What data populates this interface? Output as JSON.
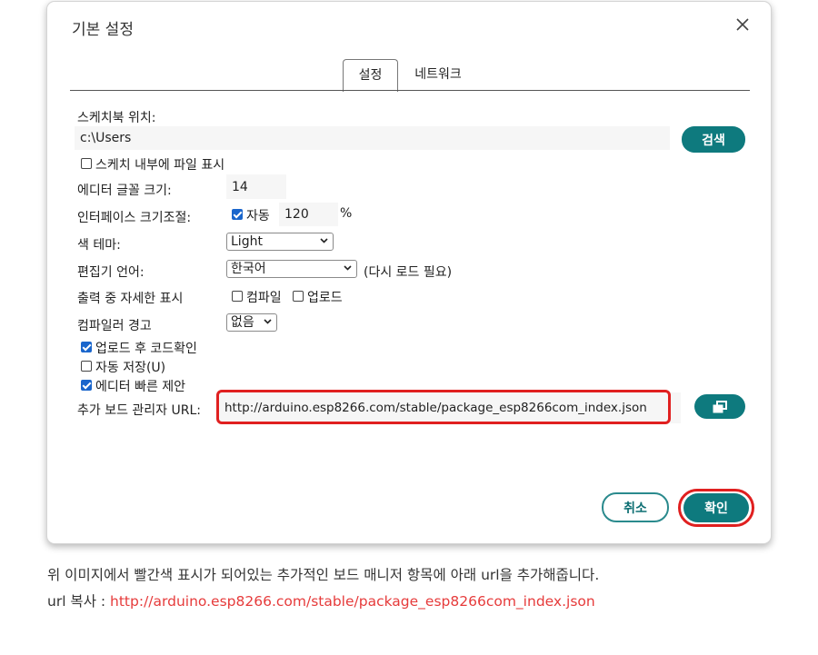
{
  "dialog": {
    "title": "기본 설정",
    "tabs": [
      {
        "label": "설정",
        "active": true
      },
      {
        "label": "네트워크",
        "active": false
      }
    ],
    "sketchbook_label": "스케치북 위치:",
    "sketchbook_path": "c:\\Users",
    "browse_label": "검색",
    "show_inside_sketch_label": "스케치 내부에 파일 표시",
    "editor_font_size_label": "에디터 글꼴 크기:",
    "editor_font_size": "14",
    "interface_scale_label": "인터페이스 크기조절:",
    "auto_label": "자동",
    "scale_value": "120",
    "percent": "%",
    "theme_label": "색 테마:",
    "theme_value": "Light",
    "language_label": "편집기 언어:",
    "language_value": "한국어",
    "reload_note": "(다시 로드 필요)",
    "verbose_label": "출력 중 자세한 표시",
    "compile_label": "컴파일",
    "upload_label": "업로드",
    "compiler_warnings_label": "컴파일러 경고",
    "compiler_warnings_value": "없음",
    "verify_after_upload_label": "업로드 후 코드확인",
    "auto_save_label": "자동 저장(U)",
    "quick_suggestions_label": "에디터 빠른 제안",
    "board_urls_label": "추가 보드 관리자 URL:",
    "board_urls_value": "http://arduino.esp8266.com/stable/package_esp8266com_index.json",
    "cancel_label": "취소",
    "ok_label": "확인"
  },
  "caption": {
    "line1": "위 이미지에서 빨간색 표시가 되어있는 추가적인 보드 매니저 항목에 아래 url을 추가해줍니다.",
    "line2_prefix": "url 복사 : ",
    "line2_link": "http://arduino.esp8266.com/stable/package_esp8266com_index.json"
  },
  "colors": {
    "accent": "#0e7a7e",
    "highlight": "#e02020",
    "link": "#e63b3b"
  }
}
